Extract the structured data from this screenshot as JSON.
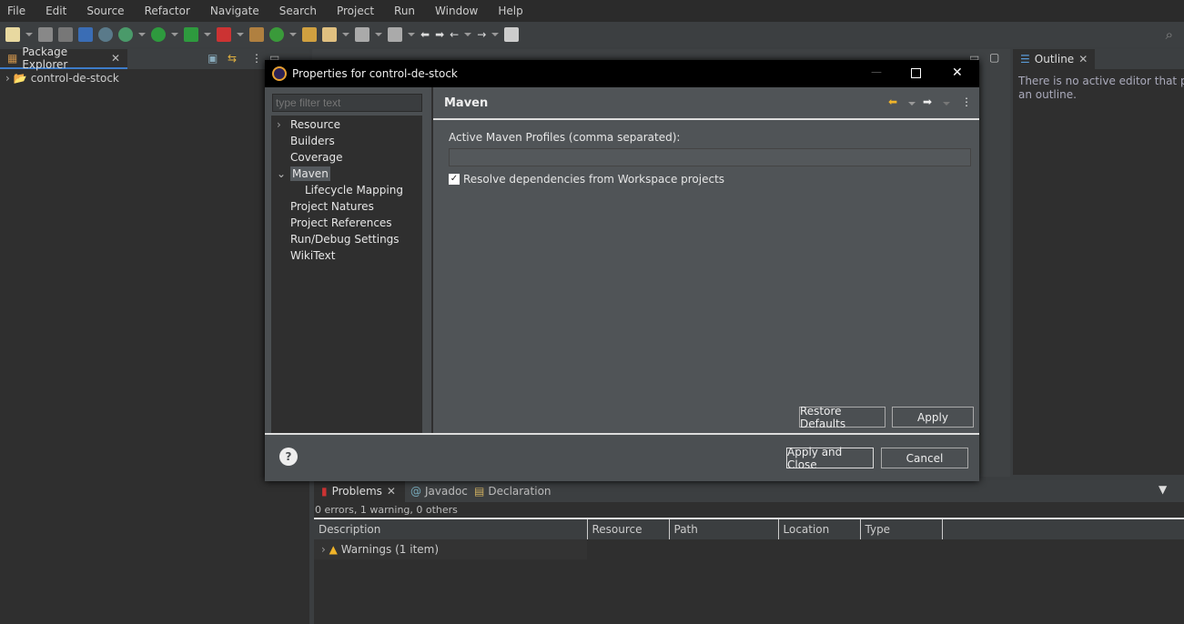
{
  "menu": [
    "File",
    "Edit",
    "Source",
    "Refactor",
    "Navigate",
    "Search",
    "Project",
    "Run",
    "Window",
    "Help"
  ],
  "package_explorer": {
    "tab": "Package Explorer",
    "project": "control-de-stock"
  },
  "outline": {
    "tab": "Outline",
    "message": "There is no active editor that provides an outline."
  },
  "dialog": {
    "title": "Properties for control-de-stock",
    "filter_placeholder": "type filter text",
    "tree": [
      {
        "label": "Resource",
        "expandable": true
      },
      {
        "label": "Builders"
      },
      {
        "label": "Coverage"
      },
      {
        "label": "Maven",
        "expanded": true,
        "selected": true
      },
      {
        "label": "Lifecycle Mapping",
        "child": true
      },
      {
        "label": "Project Natures"
      },
      {
        "label": "Project References"
      },
      {
        "label": "Run/Debug Settings"
      },
      {
        "label": "WikiText"
      }
    ],
    "page_title": "Maven",
    "profiles_label": "Active Maven Profiles (comma separated):",
    "profiles_value": "",
    "resolve_label": "Resolve dependencies from Workspace projects",
    "resolve_checked": true,
    "restore_defaults": "Restore Defaults",
    "apply": "Apply",
    "apply_close": "Apply and Close",
    "cancel": "Cancel"
  },
  "problems": {
    "tabs": [
      "Problems",
      "Javadoc",
      "Declaration"
    ],
    "summary": "0 errors, 1 warning, 0 others",
    "columns": [
      "Description",
      "Resource",
      "Path",
      "Location",
      "Type"
    ],
    "rows": [
      {
        "description": "Warnings (1 item)"
      }
    ]
  },
  "colors": {
    "accent": "#3d7cc9",
    "warning": "#f0b429"
  }
}
